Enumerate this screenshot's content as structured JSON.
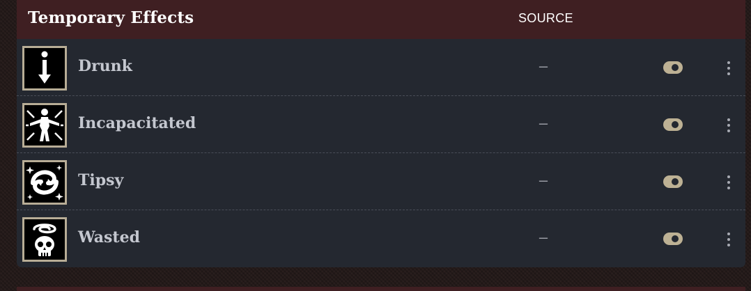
{
  "panel": {
    "title": "Temporary Effects",
    "columns": {
      "source": "SOURCE"
    }
  },
  "effects": [
    {
      "name": "Drunk",
      "source": "–",
      "enabled": true,
      "icon": "info-arrow-icon"
    },
    {
      "name": "Incapacitated",
      "source": "–",
      "enabled": true,
      "icon": "incapacitated-figure-icon"
    },
    {
      "name": "Tipsy",
      "source": "–",
      "enabled": true,
      "icon": "dizzy-spiral-icon"
    },
    {
      "name": "Wasted",
      "source": "–",
      "enabled": true,
      "icon": "skull-spiral-icon"
    }
  ],
  "colors": {
    "header_bg": "#3f1f22",
    "panel_bg": "#242830",
    "icon_border": "#b8ad96",
    "toggle_on": "#bdb194",
    "effect_name": "#c4c7cf"
  }
}
